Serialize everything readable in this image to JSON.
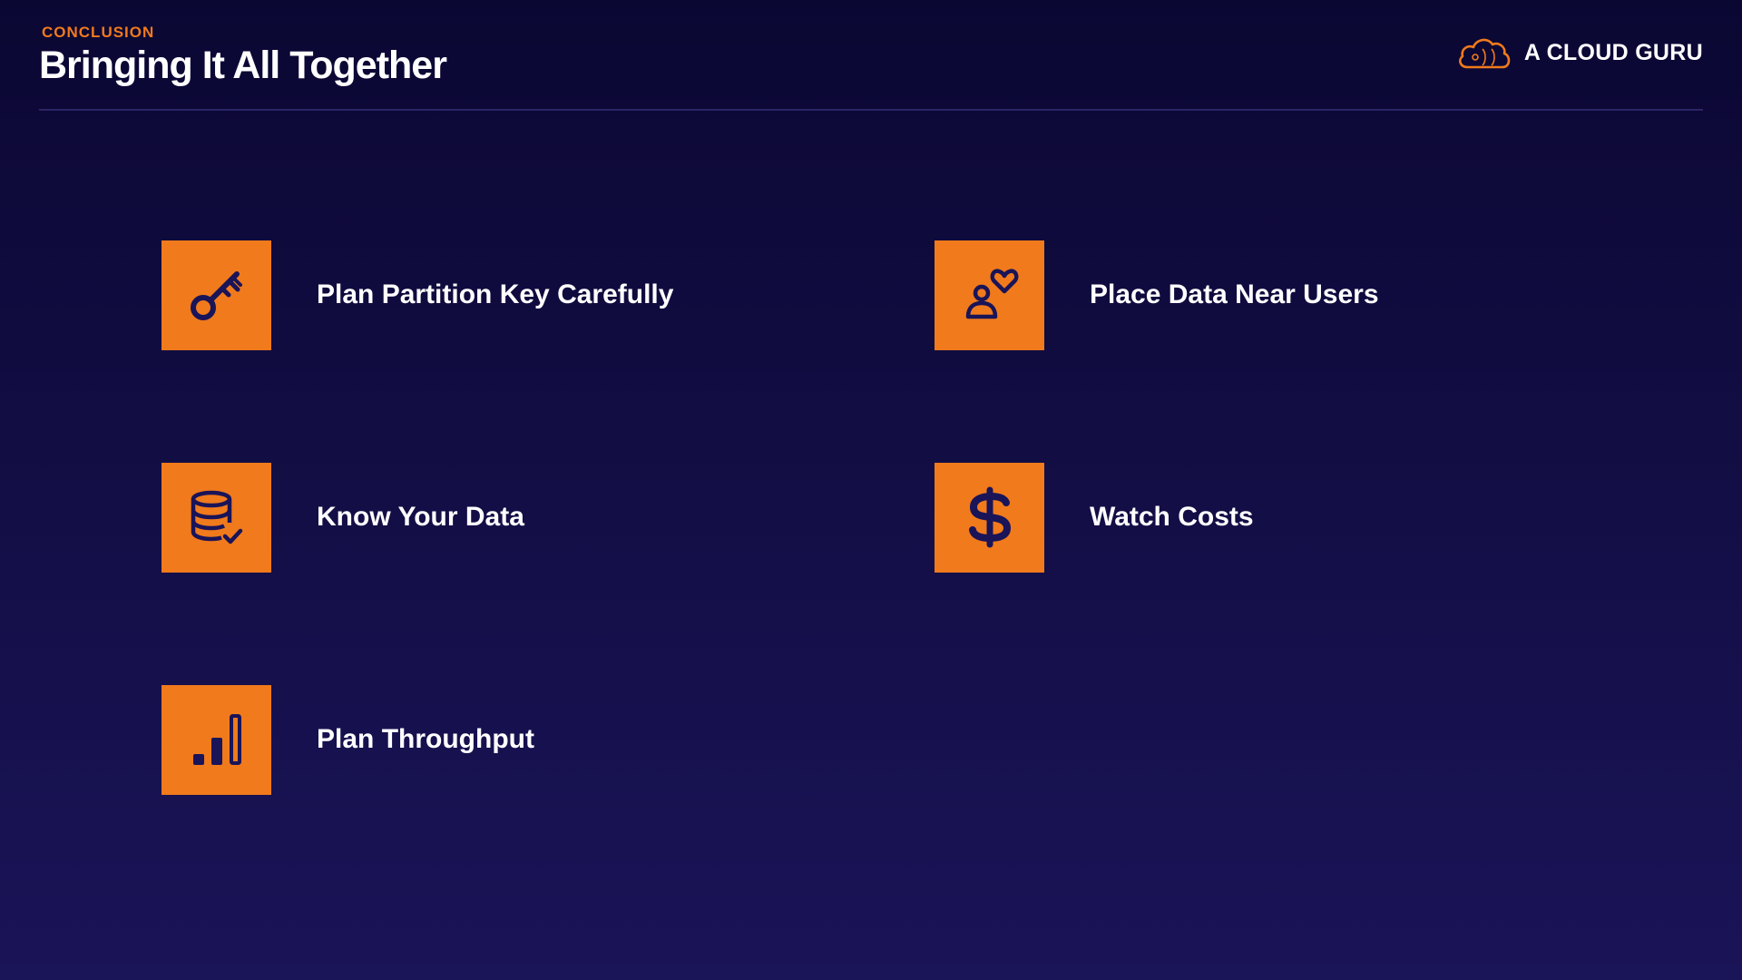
{
  "header": {
    "eyebrow": "CONCLUSION",
    "title": "Bringing It All Together"
  },
  "brand": {
    "name": "A CLOUD GURU",
    "logo_icon": "cloud-logo-icon"
  },
  "items": [
    {
      "label": "Plan Partition Key Carefully",
      "icon": "key-icon"
    },
    {
      "label": "Place Data Near Users",
      "icon": "user-heart-icon"
    },
    {
      "label": "Know Your Data",
      "icon": "database-check-icon"
    },
    {
      "label": "Watch Costs",
      "icon": "dollar-icon"
    },
    {
      "label": "Plan Throughput",
      "icon": "bar-chart-icon"
    }
  ],
  "colors": {
    "accent": "#f07a1c",
    "background_top": "#0b0733",
    "background_bottom": "#1a1458",
    "icon_glyph": "#1a1458"
  }
}
